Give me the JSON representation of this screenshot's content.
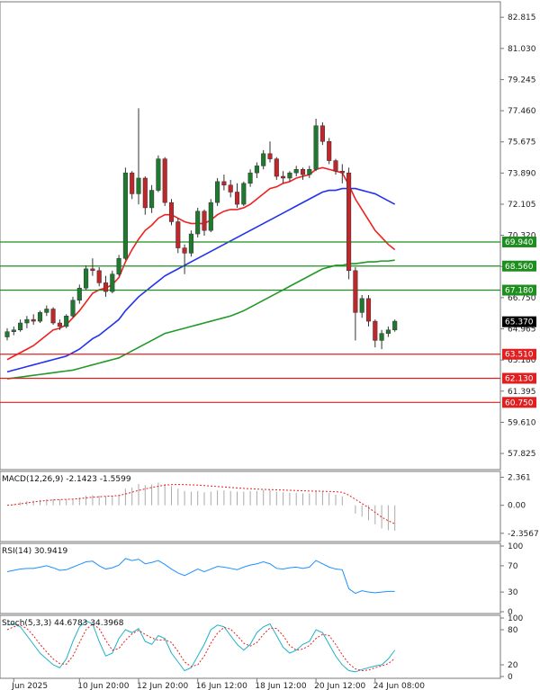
{
  "chart_data": {
    "type": "candlestick",
    "price_panel": {
      "ylim": [
        56.9,
        83.7
      ],
      "y_ticks": [
        "82.815",
        "81.030",
        "79.245",
        "77.460",
        "75.675",
        "73.890",
        "72.105",
        "70.320",
        "68.535",
        "66.750",
        "64.965",
        "63.180",
        "61.395",
        "59.610",
        "57.825"
      ],
      "current_price": "65.370",
      "levels": [
        {
          "value": 69.94,
          "label": "69.940",
          "color": "#1e8f1e"
        },
        {
          "value": 68.56,
          "label": "68.560",
          "color": "#1e8f1e"
        },
        {
          "value": 67.18,
          "label": "67.180",
          "color": "#1e8f1e"
        },
        {
          "value": 63.51,
          "label": "63.510",
          "color": "#e02020"
        },
        {
          "value": 62.13,
          "label": "62.130",
          "color": "#e02020"
        },
        {
          "value": 60.75,
          "label": "60.750",
          "color": "#e02020"
        }
      ],
      "candles": [
        [
          64.5,
          65.0,
          64.3,
          64.8
        ],
        [
          64.8,
          65.1,
          64.6,
          64.9
        ],
        [
          64.9,
          65.5,
          64.8,
          65.3
        ],
        [
          65.3,
          65.7,
          65.0,
          65.5
        ],
        [
          65.5,
          65.8,
          65.2,
          65.4
        ],
        [
          65.4,
          66.0,
          65.3,
          65.9
        ],
        [
          65.9,
          66.3,
          65.7,
          66.1
        ],
        [
          66.1,
          66.2,
          65.2,
          65.3
        ],
        [
          65.3,
          65.5,
          64.9,
          65.1
        ],
        [
          65.1,
          65.8,
          65.0,
          65.7
        ],
        [
          65.7,
          66.8,
          65.6,
          66.6
        ],
        [
          66.6,
          67.5,
          66.4,
          67.3
        ],
        [
          67.3,
          68.6,
          67.2,
          68.4
        ],
        [
          68.4,
          69.0,
          68.0,
          68.3
        ],
        [
          68.3,
          68.5,
          67.4,
          67.6
        ],
        [
          67.6,
          68.0,
          66.8,
          67.1
        ],
        [
          67.1,
          68.3,
          67.0,
          68.1
        ],
        [
          68.1,
          69.2,
          68.0,
          69.0
        ],
        [
          69.0,
          74.2,
          68.9,
          73.9
        ],
        [
          73.9,
          74.0,
          72.4,
          72.7
        ],
        [
          72.7,
          77.6,
          72.1,
          73.6
        ],
        [
          73.6,
          73.7,
          71.5,
          71.9
        ],
        [
          71.9,
          73.2,
          71.6,
          72.9
        ],
        [
          72.9,
          74.9,
          72.8,
          74.7
        ],
        [
          74.7,
          74.8,
          72.0,
          72.2
        ],
        [
          72.2,
          72.4,
          70.9,
          71.1
        ],
        [
          71.1,
          71.3,
          69.3,
          69.6
        ],
        [
          69.6,
          69.8,
          68.1,
          69.3
        ],
        [
          69.3,
          70.6,
          69.1,
          70.4
        ],
        [
          70.4,
          71.9,
          70.2,
          71.7
        ],
        [
          71.7,
          71.8,
          70.3,
          70.6
        ],
        [
          70.6,
          72.4,
          70.5,
          72.2
        ],
        [
          72.2,
          73.6,
          72.0,
          73.4
        ],
        [
          73.4,
          73.8,
          72.9,
          73.2
        ],
        [
          73.2,
          73.5,
          72.5,
          72.8
        ],
        [
          72.8,
          73.3,
          71.9,
          72.1
        ],
        [
          72.1,
          73.4,
          72.0,
          73.3
        ],
        [
          73.3,
          74.1,
          73.1,
          73.9
        ],
        [
          73.9,
          74.5,
          73.6,
          74.3
        ],
        [
          74.3,
          75.2,
          74.1,
          75.0
        ],
        [
          75.0,
          75.7,
          74.5,
          74.7
        ],
        [
          74.7,
          74.8,
          73.5,
          73.7
        ],
        [
          73.7,
          74.0,
          73.3,
          73.6
        ],
        [
          73.6,
          74.0,
          73.4,
          73.9
        ],
        [
          73.9,
          74.3,
          73.7,
          74.1
        ],
        [
          74.1,
          74.2,
          73.5,
          73.8
        ],
        [
          73.8,
          74.3,
          73.6,
          74.1
        ],
        [
          74.1,
          77.0,
          74.0,
          76.6
        ],
        [
          76.6,
          76.8,
          75.5,
          75.7
        ],
        [
          75.7,
          75.9,
          74.4,
          74.6
        ],
        [
          74.6,
          74.7,
          73.8,
          74.0
        ],
        [
          74.0,
          74.4,
          73.3,
          73.9
        ],
        [
          73.9,
          74.2,
          67.8,
          68.3
        ],
        [
          68.3,
          68.5,
          64.3,
          65.9
        ],
        [
          65.9,
          66.9,
          65.6,
          66.7
        ],
        [
          66.7,
          66.9,
          65.1,
          65.4
        ],
        [
          65.4,
          65.5,
          63.9,
          64.3
        ],
        [
          64.3,
          64.9,
          63.8,
          64.7
        ],
        [
          64.7,
          65.1,
          64.5,
          64.9
        ],
        [
          64.9,
          65.5,
          64.8,
          65.4
        ]
      ]
    },
    "x_labels": [
      {
        "index": 1,
        "text": "Jun 2025"
      },
      {
        "index": 11,
        "text": "10 Jun 20:00"
      },
      {
        "index": 20,
        "text": "12 Jun 20:00"
      },
      {
        "index": 29,
        "text": "16 Jun 12:00"
      },
      {
        "index": 38,
        "text": "18 Jun 12:00"
      },
      {
        "index": 47,
        "text": "20 Jun 12:00"
      },
      {
        "index": 56,
        "text": "24 Jun 08:00"
      }
    ],
    "macd": {
      "label": "MACD(12,26,9) -2.1423 -1.5599",
      "ylim": [
        -2.9,
        2.7
      ],
      "y_ticks": [
        "2.361",
        "0.00",
        "-2.3567"
      ],
      "histogram": [
        0.0,
        0.1,
        0.25,
        0.35,
        0.4,
        0.45,
        0.5,
        0.52,
        0.5,
        0.5,
        0.55,
        0.65,
        0.8,
        0.85,
        0.8,
        0.75,
        0.8,
        0.9,
        1.4,
        1.5,
        1.8,
        1.7,
        1.75,
        1.9,
        1.8,
        1.6,
        1.4,
        1.2,
        1.15,
        1.2,
        1.1,
        1.15,
        1.25,
        1.25,
        1.2,
        1.15,
        1.15,
        1.2,
        1.2,
        1.3,
        1.3,
        1.15,
        1.1,
        1.05,
        1.05,
        1.0,
        1.0,
        1.25,
        1.2,
        1.05,
        0.9,
        0.75,
        0.0,
        -0.7,
        -0.95,
        -1.25,
        -1.6,
        -1.95,
        -2.1,
        -2.14
      ],
      "signal": [
        0.0,
        0.05,
        0.12,
        0.2,
        0.28,
        0.35,
        0.4,
        0.45,
        0.48,
        0.5,
        0.52,
        0.56,
        0.62,
        0.68,
        0.72,
        0.75,
        0.78,
        0.82,
        0.95,
        1.1,
        1.25,
        1.38,
        1.5,
        1.6,
        1.7,
        1.74,
        1.75,
        1.74,
        1.72,
        1.7,
        1.66,
        1.62,
        1.58,
        1.54,
        1.5,
        1.46,
        1.42,
        1.39,
        1.36,
        1.34,
        1.32,
        1.3,
        1.28,
        1.26,
        1.24,
        1.22,
        1.2,
        1.19,
        1.18,
        1.16,
        1.14,
        1.1,
        0.85,
        0.5,
        0.15,
        -0.2,
        -0.6,
        -1.0,
        -1.3,
        -1.56
      ]
    },
    "rsi": {
      "label": "RSI(14) 30.9419",
      "ylim": [
        0,
        100
      ],
      "y_ticks": [
        "100",
        "70",
        "30",
        "0"
      ],
      "values": [
        61,
        63,
        65,
        66,
        66,
        68,
        70,
        67,
        63,
        64,
        68,
        72,
        76,
        77,
        70,
        65,
        67,
        71,
        81,
        78,
        80,
        73,
        75,
        78,
        72,
        65,
        59,
        55,
        60,
        65,
        61,
        65,
        69,
        68,
        66,
        64,
        68,
        71,
        73,
        76,
        73,
        66,
        65,
        67,
        68,
        66,
        68,
        78,
        73,
        68,
        65,
        64,
        35,
        28,
        32,
        30,
        29,
        30,
        31,
        31
      ]
    },
    "stoch": {
      "label": "Stoch(5,3,3) 44.6783 34.3968",
      "ylim": [
        0,
        100
      ],
      "y_ticks": [
        "100",
        "80",
        "20",
        "0"
      ],
      "k": [
        88,
        90,
        85,
        70,
        55,
        40,
        30,
        20,
        15,
        30,
        60,
        85,
        95,
        90,
        60,
        35,
        40,
        65,
        80,
        75,
        82,
        60,
        55,
        70,
        65,
        40,
        25,
        10,
        15,
        35,
        55,
        80,
        88,
        85,
        70,
        55,
        45,
        55,
        75,
        85,
        90,
        70,
        50,
        40,
        45,
        55,
        60,
        80,
        75,
        55,
        35,
        20,
        10,
        8,
        12,
        15,
        18,
        20,
        30,
        45
      ],
      "d": [
        80,
        85,
        88,
        82,
        70,
        55,
        42,
        30,
        22,
        21,
        35,
        58,
        80,
        90,
        82,
        62,
        45,
        48,
        62,
        73,
        79,
        72,
        66,
        62,
        63,
        58,
        43,
        25,
        17,
        20,
        35,
        57,
        74,
        84,
        81,
        70,
        57,
        52,
        58,
        72,
        83,
        82,
        70,
        53,
        45,
        47,
        53,
        65,
        72,
        70,
        55,
        37,
        22,
        13,
        10,
        11,
        15,
        18,
        22,
        31
      ]
    },
    "overlays": [
      {
        "color": "#ee2222",
        "values": [
          63.2,
          63.4,
          63.6,
          63.8,
          64.0,
          64.3,
          64.6,
          64.9,
          65.0,
          65.2,
          65.6,
          66.0,
          66.5,
          67.0,
          67.2,
          67.3,
          67.5,
          67.9,
          68.8,
          69.5,
          70.1,
          70.6,
          70.9,
          71.3,
          71.5,
          71.5,
          71.3,
          71.1,
          71.0,
          71.0,
          71.0,
          71.2,
          71.5,
          71.7,
          71.8,
          71.8,
          71.9,
          72.1,
          72.4,
          72.7,
          73.0,
          73.1,
          73.3,
          73.4,
          73.6,
          73.7,
          73.8,
          74.1,
          74.2,
          74.1,
          74.0,
          73.9,
          73.2,
          72.4,
          71.8,
          71.2,
          70.6,
          70.2,
          69.8,
          69.5
        ]
      },
      {
        "color": "#2233ee",
        "values": [
          62.5,
          62.6,
          62.7,
          62.8,
          62.9,
          63.0,
          63.1,
          63.2,
          63.3,
          63.4,
          63.6,
          63.8,
          64.1,
          64.4,
          64.6,
          64.9,
          65.2,
          65.5,
          66.0,
          66.4,
          66.8,
          67.1,
          67.4,
          67.7,
          68.0,
          68.2,
          68.4,
          68.6,
          68.8,
          69.0,
          69.2,
          69.4,
          69.6,
          69.8,
          70.0,
          70.2,
          70.4,
          70.6,
          70.8,
          71.0,
          71.2,
          71.4,
          71.6,
          71.8,
          72.0,
          72.2,
          72.4,
          72.6,
          72.8,
          72.9,
          72.9,
          73.0,
          73.0,
          73.0,
          72.9,
          72.8,
          72.7,
          72.5,
          72.3,
          72.1
        ]
      },
      {
        "color": "#22992a",
        "values": [
          62.1,
          62.15,
          62.2,
          62.25,
          62.3,
          62.35,
          62.4,
          62.45,
          62.5,
          62.55,
          62.6,
          62.7,
          62.8,
          62.9,
          63.0,
          63.1,
          63.2,
          63.3,
          63.5,
          63.7,
          63.9,
          64.1,
          64.3,
          64.5,
          64.7,
          64.8,
          64.9,
          65.0,
          65.1,
          65.2,
          65.3,
          65.4,
          65.5,
          65.6,
          65.7,
          65.85,
          66.0,
          66.2,
          66.4,
          66.6,
          66.8,
          67.0,
          67.2,
          67.4,
          67.6,
          67.8,
          68.0,
          68.2,
          68.4,
          68.5,
          68.6,
          68.6,
          68.7,
          68.7,
          68.75,
          68.8,
          68.8,
          68.85,
          68.85,
          68.9
        ]
      }
    ]
  }
}
